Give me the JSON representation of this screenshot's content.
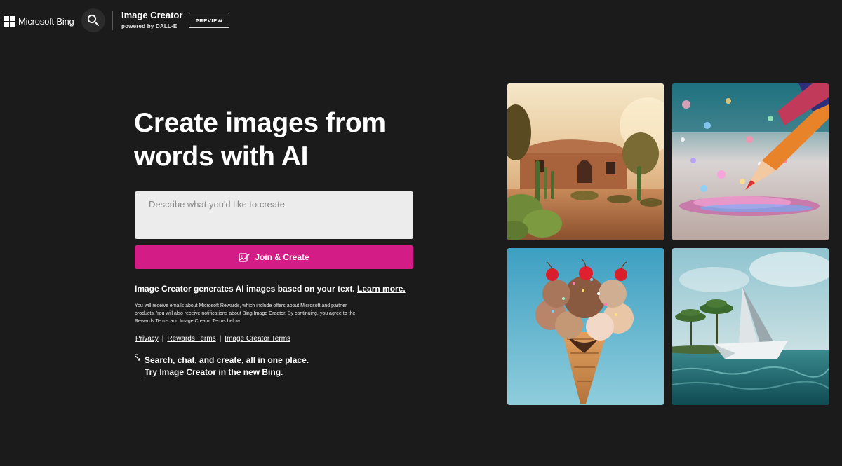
{
  "header": {
    "brand": "Microsoft Bing",
    "app_title": "Image Creator",
    "app_subtitle": "powered by DALL·E",
    "badge": "PREVIEW",
    "icons": [
      "microsoft-logo-icon",
      "search-icon"
    ]
  },
  "hero": {
    "title_line1": "Create images from",
    "title_line2": "words with AI",
    "prompt_placeholder": "Describe what you'd like to create",
    "prompt_value": "",
    "create_button": "Join & Create"
  },
  "info": {
    "text": "Image Creator generates AI images based on your text.",
    "learn_more": "Learn more.",
    "fine_print": "You will receive emails about Microsoft Rewards, which include offers about Microsoft and partner products. You will also receive notifications about Bing Image Creator. By continuing, you agree to the Rewards Terms and Image Creator Terms below."
  },
  "links": {
    "privacy": "Privacy",
    "rewards_terms": "Rewards Terms",
    "image_creator_terms": "Image Creator Terms",
    "separator": "|"
  },
  "promo": {
    "text": "Search, chat, and create, all in one place.",
    "link": "Try Image Creator in the new Bing."
  },
  "gallery": {
    "tiles": [
      "desert-house-image",
      "pencil-sparkles-image",
      "ice-cream-cone-image",
      "paper-boat-image"
    ]
  },
  "colors": {
    "background": "#1b1b1b",
    "accent": "#d41c86",
    "input_bg": "#ececec"
  }
}
